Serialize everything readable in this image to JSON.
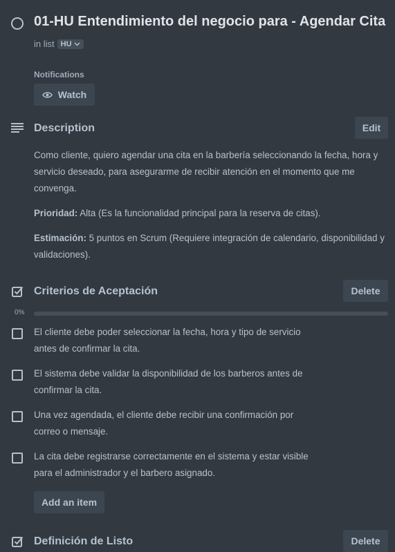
{
  "card": {
    "title": "01-HU Entendimiento del negocio para - Agendar Cita",
    "in_list_label": "in list",
    "list_name": "HU"
  },
  "notifications": {
    "label": "Notifications",
    "watch_label": "Watch"
  },
  "description": {
    "heading": "Description",
    "edit_label": "Edit",
    "paragraph": "Como cliente, quiero agendar una cita en la barbería seleccionando la fecha, hora y servicio deseado, para asegurarme de recibir atención en el momento que me convenga.",
    "priority_label": "Prioridad:",
    "priority_text": " Alta (Es la funcionalidad principal para la reserva de citas).",
    "estimate_label": "Estimación:",
    "estimate_text": " 5 puntos en Scrum (Requiere integración de calendario, disponibilidad y validaciones)."
  },
  "checklist": {
    "heading": "Criterios de Aceptación",
    "delete_label": "Delete",
    "progress_text": "0%",
    "progress": 0,
    "items": [
      "El cliente debe poder seleccionar la fecha, hora y tipo de servicio antes de confirmar la cita.",
      "El sistema debe validar la disponibilidad de los barberos antes de confirmar la cita.",
      "Una vez agendada, el cliente debe recibir una confirmación por correo o mensaje.",
      "La cita debe registrarse correctamente en el sistema y estar visible para el administrador y el barbero asignado."
    ],
    "add_item_label": "Add an item"
  },
  "checklist2": {
    "heading": "Definición de Listo",
    "delete_label": "Delete"
  },
  "colors": {
    "background": "#323940",
    "text": "#b6c2cf",
    "button": "#3c4650"
  }
}
